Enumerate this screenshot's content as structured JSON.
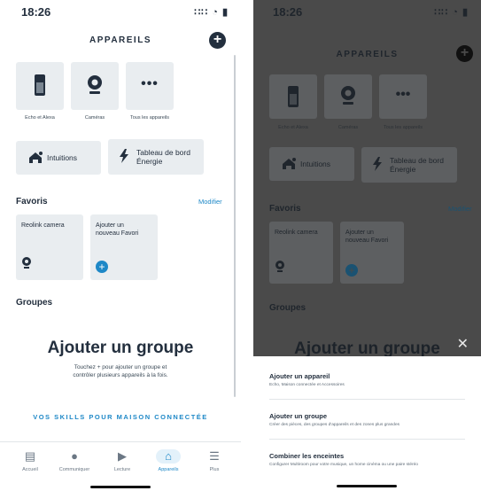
{
  "status": {
    "time": "18:26",
    "icons": "∷∷ ◔ ▮"
  },
  "header": {
    "title": "APPAREILS",
    "add_icon": "+"
  },
  "categories": [
    {
      "label": "Echo et Alexa",
      "icon": "speaker-icon"
    },
    {
      "label": "Caméras",
      "icon": "camera-icon"
    },
    {
      "label": "Tous les appareils",
      "icon": "more-icon"
    }
  ],
  "shortcuts": [
    {
      "label": "Intuitions",
      "icon": "insights-icon"
    },
    {
      "label_line1": "Tableau de bord",
      "label_line2": "Énergie",
      "icon": "bolt-icon"
    }
  ],
  "favorites": {
    "title": "Favoris",
    "modify": "Modifier",
    "items": [
      {
        "label": "Reolink camera"
      },
      {
        "label_line1": "Ajouter un",
        "label_line2": "nouveau Favori"
      }
    ]
  },
  "groups": {
    "title": "Groupes",
    "add_title": "Ajouter un groupe",
    "desc_line1": "Touchez + pour ajouter un groupe et",
    "desc_line2": "contrôler plusieurs appareils à la fois."
  },
  "skills_link": "VOS SKILLS POUR MAISON CONNECTÉE",
  "tabs": [
    {
      "label": "Accueil"
    },
    {
      "label": "Communiquer"
    },
    {
      "label": "Lecture"
    },
    {
      "label": "Appareils"
    },
    {
      "label": "Plus"
    }
  ],
  "sheet": {
    "title": "Ajouter un groupe",
    "options": [
      {
        "title": "Ajouter un appareil",
        "desc": "Echo, Maison connectée et Accessoires"
      },
      {
        "title": "Ajouter un groupe",
        "desc": "Créer des pièces, des groupes d'appareils et des zones plus grandes"
      },
      {
        "title": "Combiner les enceintes",
        "desc": "Configurer Multiroom pour votre musique, un home cinéma ou une paire stéréo"
      }
    ]
  }
}
